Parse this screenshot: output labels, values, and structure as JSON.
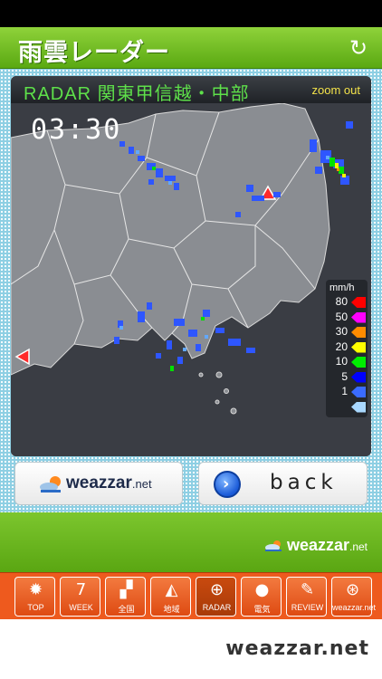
{
  "header": {
    "title": "雨雲レーダー",
    "refresh_icon": "refresh-icon"
  },
  "radar": {
    "title": "RADAR 関東甲信越・中部",
    "zoom_out": "zoom out",
    "time": "03:30",
    "legend": {
      "unit": "mm/h",
      "levels": [
        {
          "label": "80",
          "color": "#ff0000"
        },
        {
          "label": "50",
          "color": "#ff00ff"
        },
        {
          "label": "30",
          "color": "#ff8c00"
        },
        {
          "label": "20",
          "color": "#ffff00"
        },
        {
          "label": "10",
          "color": "#00ee00"
        },
        {
          "label": "5",
          "color": "#0000ff"
        },
        {
          "label": "1",
          "color": "#3a6bff"
        },
        {
          "label": "",
          "color": "#a9d8ff"
        }
      ]
    }
  },
  "buttons": {
    "weazzar_text": "weazzar",
    "weazzar_suffix": ".net",
    "back_label": "back"
  },
  "footer": {
    "logo_text": "weazzar",
    "logo_suffix": ".net"
  },
  "tabs": [
    {
      "label": "TOP",
      "icon": "sun-icon",
      "glyph": "✹"
    },
    {
      "label": "WEEK",
      "icon": "calendar-icon",
      "glyph": "7"
    },
    {
      "label": "全国",
      "icon": "japan-map-icon",
      "glyph": "▞"
    },
    {
      "label": "地域",
      "icon": "region-map-icon",
      "glyph": "◭"
    },
    {
      "label": "RADAR",
      "icon": "radar-icon",
      "glyph": "⊕"
    },
    {
      "label": "電気",
      "icon": "lightbulb-icon",
      "glyph": "●"
    },
    {
      "label": "REVIEW",
      "icon": "review-icon",
      "glyph": "✎"
    },
    {
      "label": "weazzar.net",
      "icon": "globe-icon",
      "glyph": "⊛"
    }
  ],
  "brand_bottom": "weazzar.net"
}
